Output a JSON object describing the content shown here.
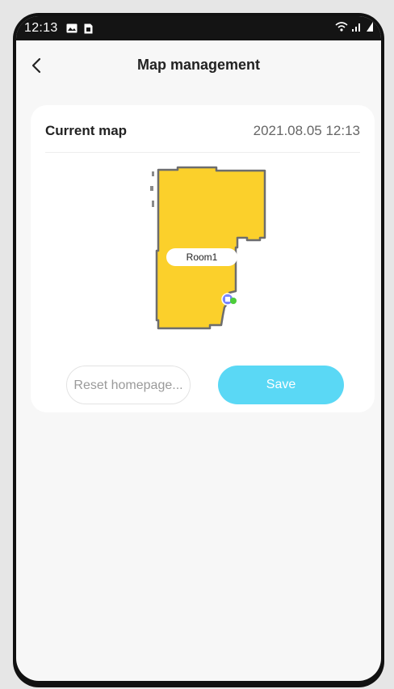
{
  "status_bar": {
    "time": "12:13",
    "icons": [
      "image-icon",
      "sim-icon"
    ],
    "right_icons": [
      "wifi-icon",
      "signal-icon",
      "battery-icon"
    ]
  },
  "header": {
    "back_icon": "chevron-left-icon",
    "title": "Map management"
  },
  "card": {
    "label": "Current map",
    "date": "2021.08.05 12:13",
    "map": {
      "room_label": "Room1",
      "fill_color": "#fbd02b",
      "outline_color": "#6d6d6d",
      "dock_icon": "charging-dock-icon"
    },
    "buttons": {
      "reset": "Reset homepage...",
      "save": "Save"
    },
    "colors": {
      "save_bg": "#5ad8f5"
    }
  }
}
